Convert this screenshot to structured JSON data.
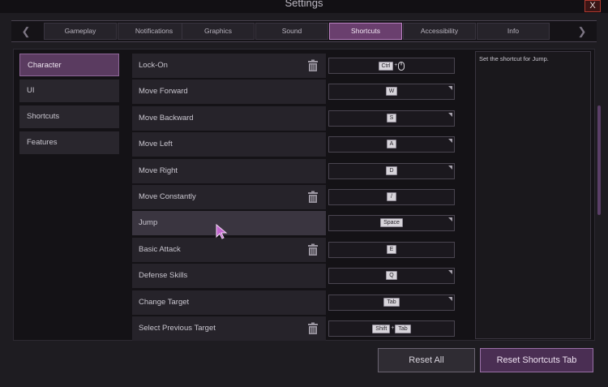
{
  "window": {
    "title": "Settings",
    "close_label": "X"
  },
  "tabs": [
    {
      "label": "Gameplay"
    },
    {
      "label": "Notifications"
    },
    {
      "label": "Graphics"
    },
    {
      "label": "Sound"
    },
    {
      "label": "Shortcuts",
      "active": true
    },
    {
      "label": "Accessibility"
    },
    {
      "label": "Info"
    }
  ],
  "sidebar": {
    "items": [
      {
        "label": "Character",
        "active": true
      },
      {
        "label": "UI"
      },
      {
        "label": "Shortcuts"
      },
      {
        "label": "Features"
      }
    ]
  },
  "shortcuts": {
    "rows": [
      {
        "name": "Lock-On",
        "keys": [
          "Ctrl"
        ],
        "mouse": true,
        "delete": true
      },
      {
        "name": "Move Forward",
        "keys": [
          "W"
        ],
        "corner": true
      },
      {
        "name": "Move Backward",
        "keys": [
          "S"
        ],
        "corner": true
      },
      {
        "name": "Move Left",
        "keys": [
          "A"
        ],
        "corner": true
      },
      {
        "name": "Move Right",
        "keys": [
          "D"
        ],
        "corner": true
      },
      {
        "name": "Move Constantly",
        "keys": [
          "/"
        ],
        "delete": true
      },
      {
        "name": "Jump",
        "keys": [
          "Space"
        ],
        "corner": true,
        "highlight": true
      },
      {
        "name": "Basic Attack",
        "keys": [
          "E"
        ],
        "delete": true
      },
      {
        "name": "Defense Skills",
        "keys": [
          "Q"
        ],
        "corner": true
      },
      {
        "name": "Change Target",
        "keys": [
          "Tab"
        ],
        "corner": true
      },
      {
        "name": "Select Previous Target",
        "keys": [
          "Shift",
          "Tab"
        ],
        "delete": true
      }
    ]
  },
  "description": {
    "text": "Set the shortcut for Jump."
  },
  "footer": {
    "reset_all_label": "Reset All",
    "reset_tab_label": "Reset Shortcuts Tab"
  },
  "colors": {
    "accent": "#6a3f6e",
    "accent_border": "#b87fc0",
    "background": "#1e1c21"
  }
}
